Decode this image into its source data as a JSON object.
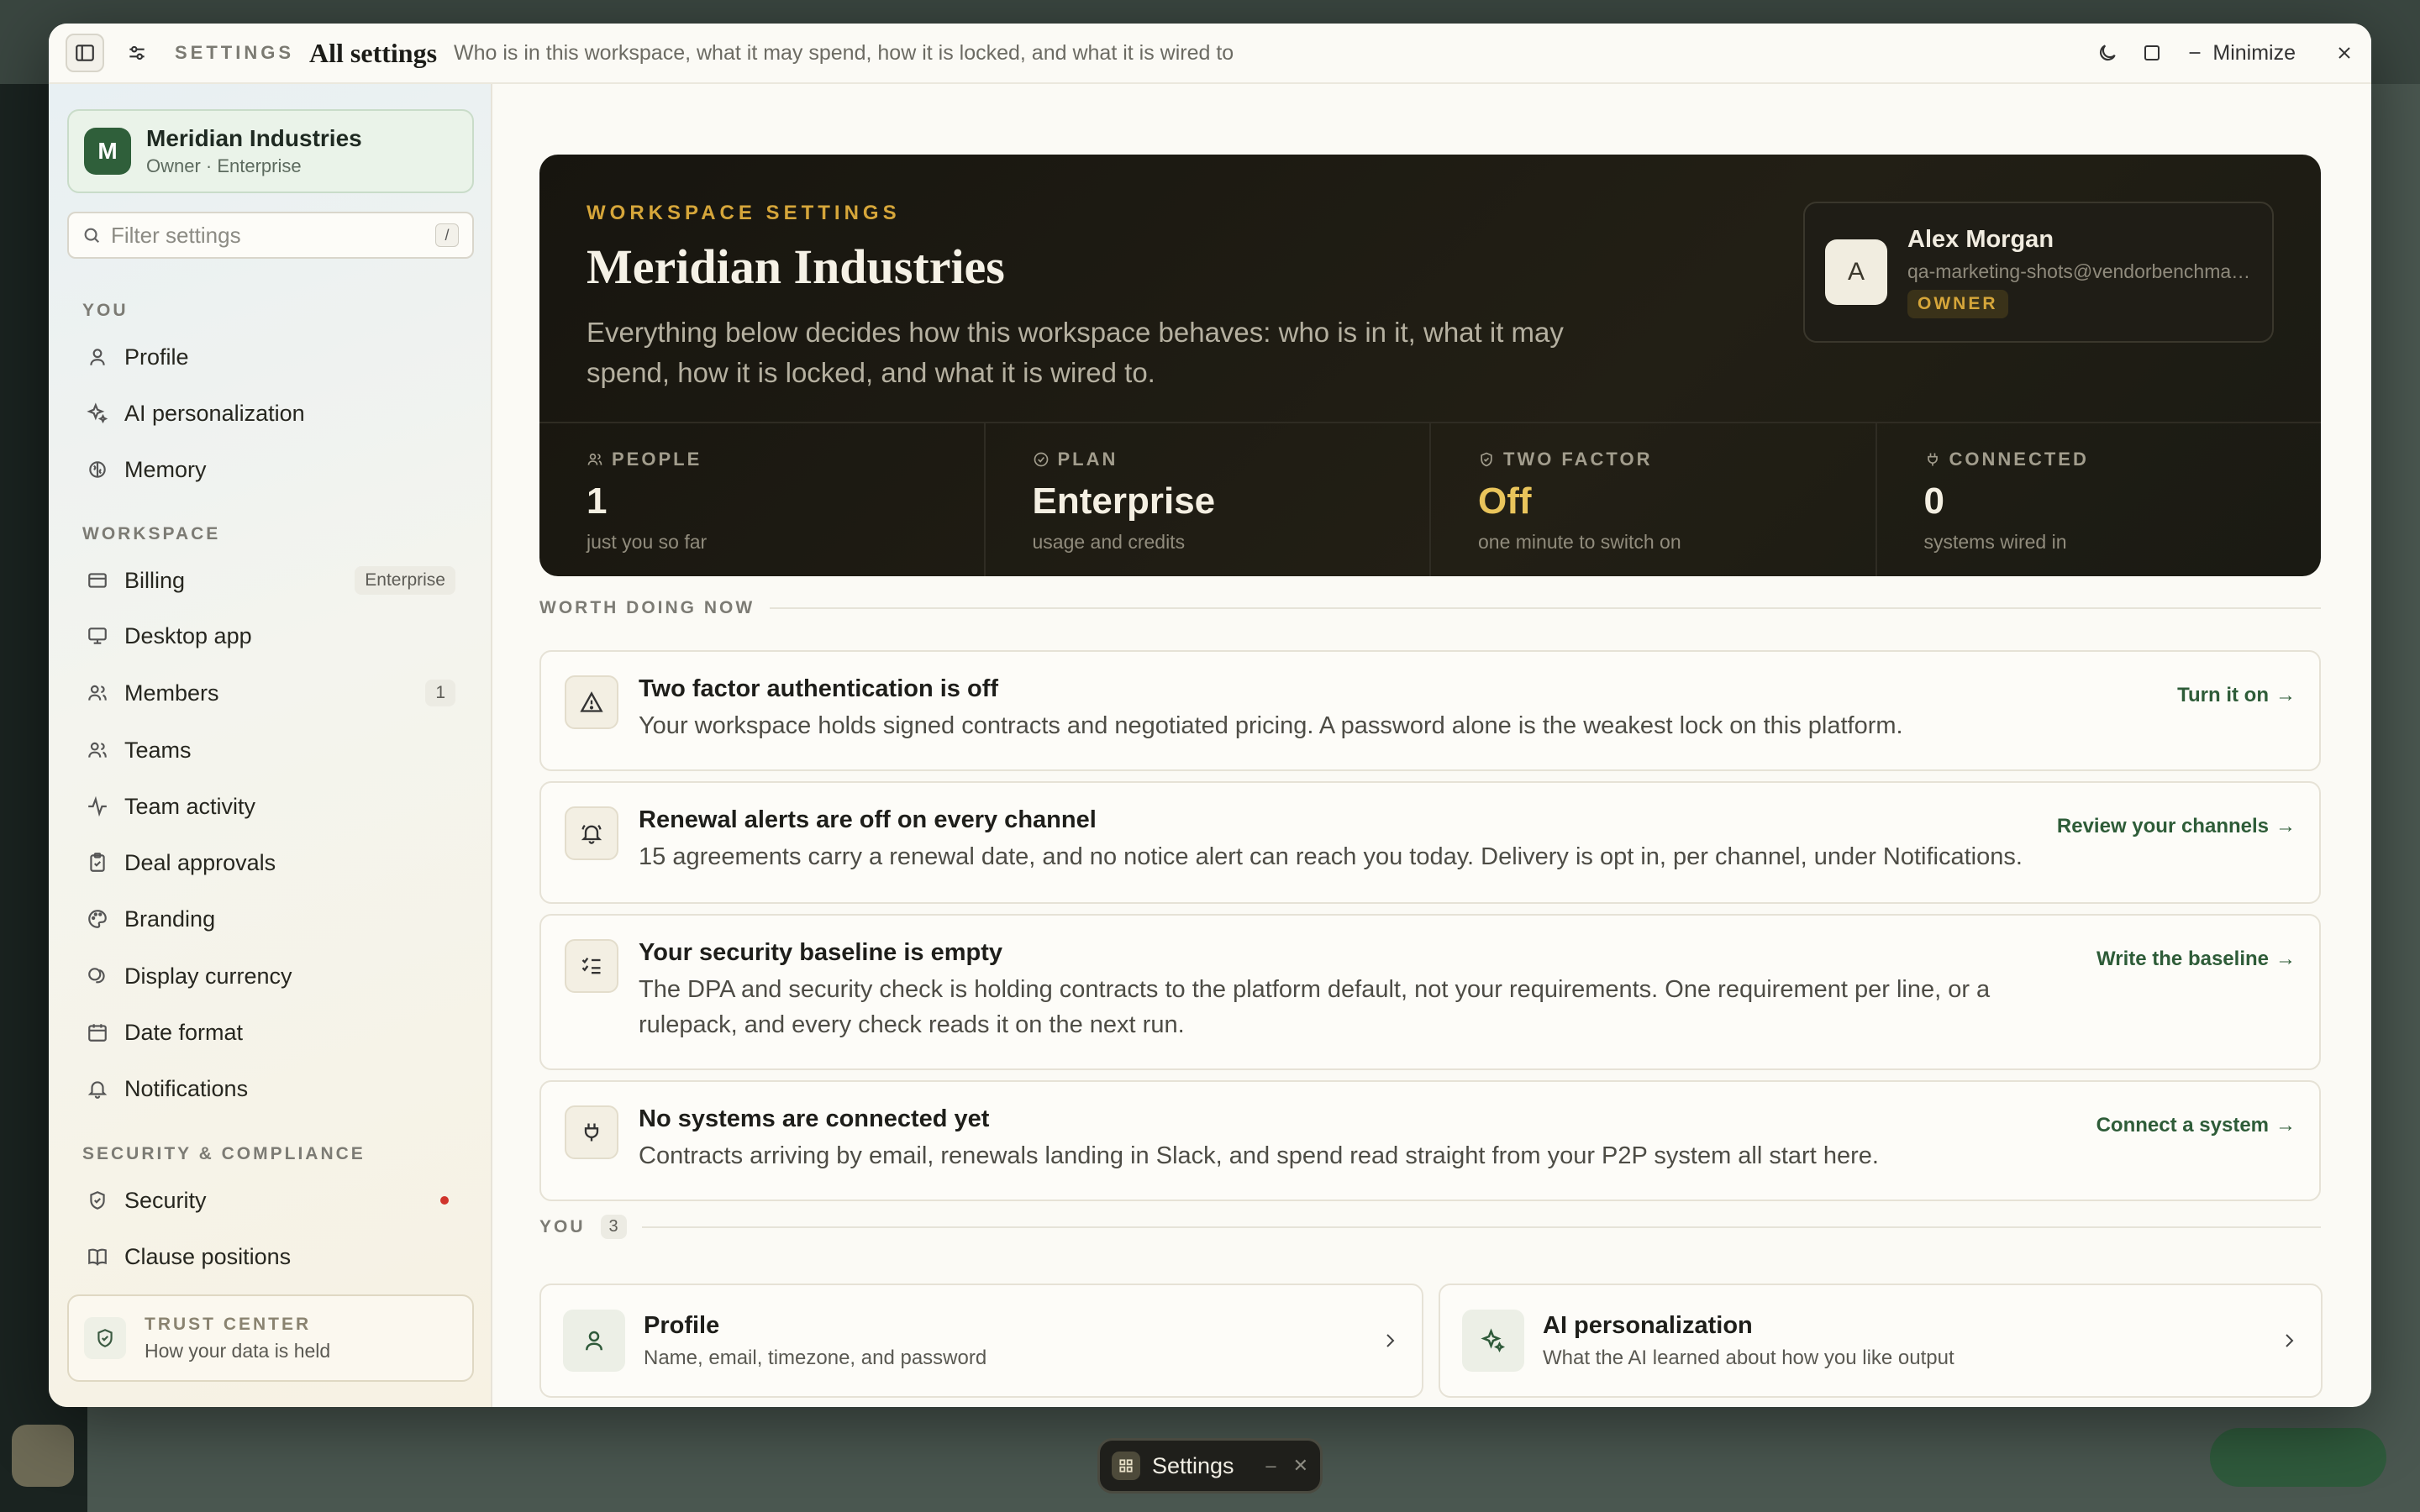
{
  "titlebar": {
    "section": "SETTINGS",
    "title": "All settings",
    "subtitle": "Who is in this workspace, what it may spend, how it is locked, and what it is wired to",
    "minimize_label": "Minimize"
  },
  "sidebar": {
    "workspace_name": "Meridian Industries",
    "workspace_role": "Owner · Enterprise",
    "workspace_initial": "M",
    "filter_placeholder": "Filter settings",
    "filter_shortcut": "/",
    "sections": {
      "you": "YOU",
      "workspace": "WORKSPACE",
      "security": "SECURITY & COMPLIANCE"
    },
    "items": [
      {
        "label": "Profile",
        "icon": "user-icon"
      },
      {
        "label": "AI personalization",
        "icon": "sparkles-icon"
      },
      {
        "label": "Memory",
        "icon": "brain-icon"
      },
      {
        "label": "Billing",
        "icon": "credit-card-icon",
        "tag": "Enterprise"
      },
      {
        "label": "Desktop app",
        "icon": "monitor-icon"
      },
      {
        "label": "Members",
        "icon": "users-icon",
        "count": "1"
      },
      {
        "label": "Teams",
        "icon": "users-icon"
      },
      {
        "label": "Team activity",
        "icon": "activity-icon"
      },
      {
        "label": "Deal approvals",
        "icon": "clipboard-check-icon"
      },
      {
        "label": "Branding",
        "icon": "palette-icon"
      },
      {
        "label": "Display currency",
        "icon": "coins-icon"
      },
      {
        "label": "Date format",
        "icon": "calendar-icon"
      },
      {
        "label": "Notifications",
        "icon": "bell-icon"
      },
      {
        "label": "Security",
        "icon": "shield-icon",
        "alert": true
      },
      {
        "label": "Clause positions",
        "icon": "book-icon"
      }
    ],
    "trust": {
      "title": "TRUST CENTER",
      "subtitle": "How your data is held"
    }
  },
  "hero": {
    "eyebrow": "WORKSPACE SETTINGS",
    "title": "Meridian Industries",
    "description": "Everything below decides how this workspace behaves: who is in it, what it may spend, how it is locked, and what it is wired to.",
    "user": {
      "initial": "A",
      "name": "Alex Morgan",
      "email": "qa-marketing-shots@vendorbenchmark.com",
      "role": "OWNER"
    },
    "stats": [
      {
        "label": "PEOPLE",
        "value": "1",
        "sub": "just you so far",
        "icon": "users-icon"
      },
      {
        "label": "PLAN",
        "value": "Enterprise",
        "sub": "usage and credits",
        "icon": "check-circle-icon"
      },
      {
        "label": "TWO FACTOR",
        "value": "Off",
        "sub": "one minute to switch on",
        "icon": "shield-check-icon"
      },
      {
        "label": "CONNECTED",
        "value": "0",
        "sub": "systems wired in",
        "icon": "plug-icon"
      }
    ]
  },
  "worth_doing": {
    "heading": "WORTH DOING NOW",
    "tasks": [
      {
        "title": "Two factor authentication is off",
        "desc": "Your workspace holds signed contracts and negotiated pricing. A password alone is the weakest lock on this platform.",
        "action": "Turn it on",
        "icon": "alert-triangle-icon"
      },
      {
        "title": "Renewal alerts are off on every channel",
        "desc": "15 agreements carry a renewal date, and no notice alert can reach you today. Delivery is opt in, per channel, under Notifications.",
        "action": "Review your channels",
        "icon": "bell-ring-icon"
      },
      {
        "title": "Your security baseline is empty",
        "desc": "The DPA and security check is holding contracts to the platform default, not your requirements. One requirement per line, or a rulepack, and every check reads it on the next run.",
        "action": "Write the baseline",
        "icon": "list-checks-icon"
      },
      {
        "title": "No systems are connected yet",
        "desc": "Contracts arriving by email, renewals landing in Slack, and spend read straight from your P2P system all start here.",
        "action": "Connect a system",
        "icon": "plug-icon"
      }
    ]
  },
  "you_section": {
    "heading": "YOU",
    "count": "3",
    "cards": [
      {
        "title": "Profile",
        "sub": "Name, email, timezone, and password",
        "icon": "user-icon"
      },
      {
        "title": "AI personalization",
        "sub": "What the AI learned about how you like output",
        "icon": "sparkles-icon"
      }
    ]
  },
  "dock": {
    "label": "Settings"
  },
  "colors": {
    "accent": "#2f5f3a",
    "hero_bg": "#17150f",
    "gold": "#d6a63a",
    "alert": "#d0342c"
  }
}
